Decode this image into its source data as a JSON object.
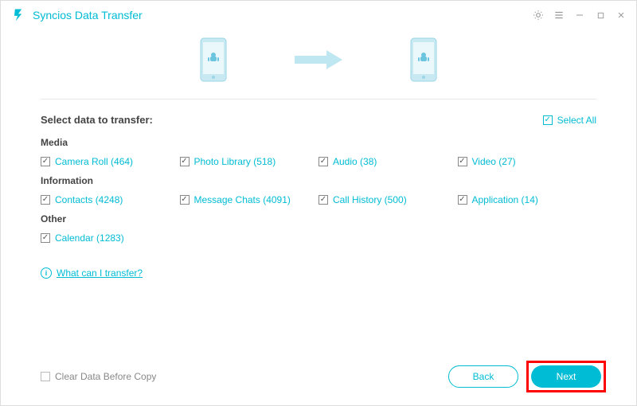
{
  "app": {
    "title": "Syncios Data Transfer"
  },
  "heading": "Select data to transfer:",
  "selectAll": "Select All",
  "sections": {
    "media": {
      "title": "Media",
      "items": [
        {
          "label": "Camera Roll (464)"
        },
        {
          "label": "Photo Library (518)"
        },
        {
          "label": "Audio (38)"
        },
        {
          "label": "Video (27)"
        }
      ]
    },
    "information": {
      "title": "Information",
      "items": [
        {
          "label": "Contacts (4248)"
        },
        {
          "label": "Message Chats (4091)"
        },
        {
          "label": "Call History (500)"
        },
        {
          "label": "Application (14)"
        }
      ]
    },
    "other": {
      "title": "Other",
      "items": [
        {
          "label": "Calendar (1283)"
        }
      ]
    }
  },
  "help": "What can I transfer?",
  "clearOption": "Clear Data Before Copy",
  "buttons": {
    "back": "Back",
    "next": "Next"
  }
}
